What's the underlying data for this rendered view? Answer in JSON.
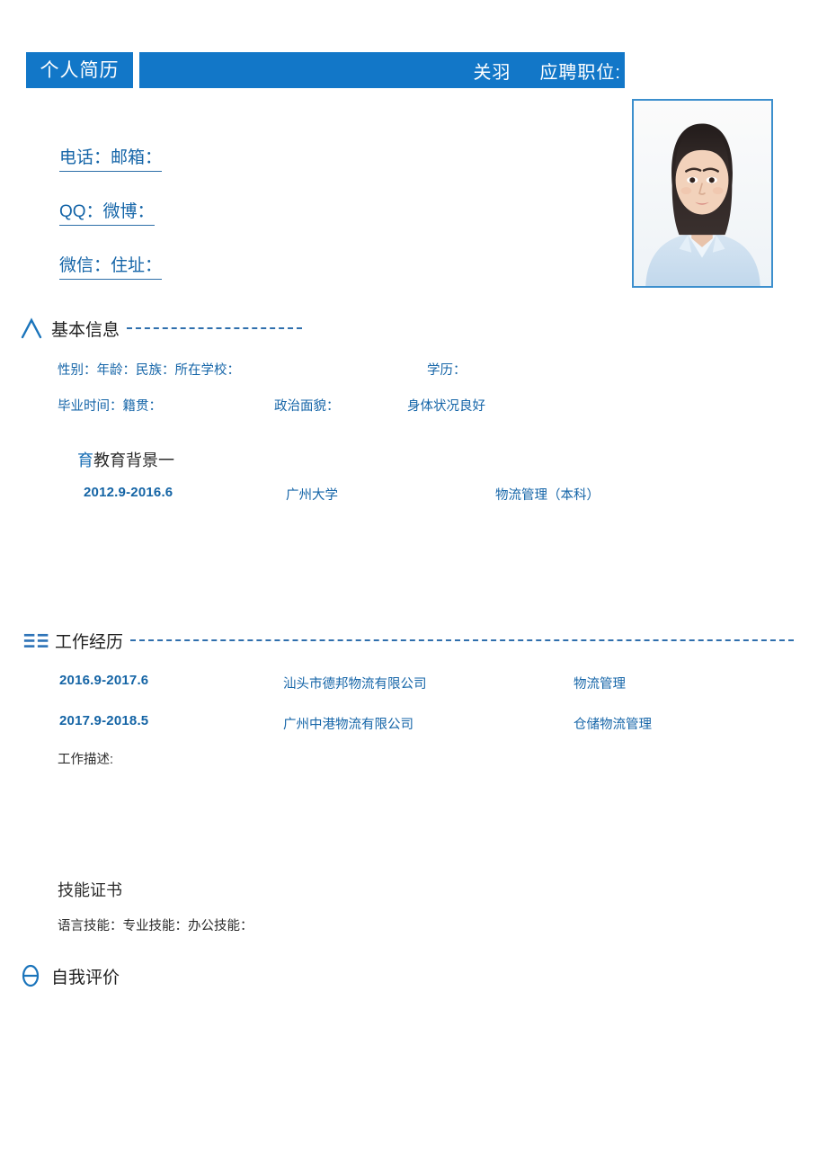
{
  "header": {
    "doc_title": "个人简历",
    "name": "关羽",
    "position_label": "应聘职位:",
    "accent_color": "#1277c8"
  },
  "photo": {
    "alt_name": "证件照"
  },
  "contact": {
    "rows": [
      {
        "text": "电话：邮箱："
      },
      {
        "text": "QQ：微博："
      },
      {
        "text": "微信：住址："
      }
    ]
  },
  "basic_info": {
    "heading": "基本信息",
    "icon": "chevron-up-icon",
    "line1": {
      "left": "性别：年龄：民族：所在学校：",
      "right": "学历："
    },
    "line2": {
      "a": "毕业时间：籍贯：",
      "b": "政治面貌：",
      "c": "身体状况良好"
    }
  },
  "education": {
    "heading_glyph": "育",
    "heading": "教育背景一",
    "entries": [
      {
        "date": "2012.9-2016.6",
        "org": "广州大学",
        "role": "物流管理（本科）"
      }
    ]
  },
  "work": {
    "heading": "工作经历",
    "icon": "list-lines-icon",
    "entries": [
      {
        "date": "2016.9-2017.6",
        "org": "汕头市德邦物流有限公司",
        "role": "物流管理"
      },
      {
        "date": "2017.9-2018.5",
        "org": "广州中港物流有限公司",
        "role": "仓储物流管理"
      }
    ],
    "description_label": "工作描述:"
  },
  "skills": {
    "heading": "技能证书",
    "line": "语言技能：专业技能：办公技能："
  },
  "self_eval": {
    "heading": "自我评价",
    "icon": "theta-icon"
  }
}
